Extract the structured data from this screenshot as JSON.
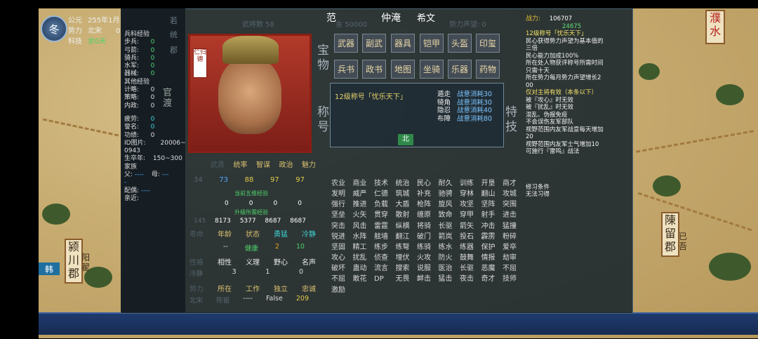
{
  "top_left": {
    "season": "冬",
    "row1_label": "公元",
    "row1_value": "255年1月1",
    "row2_label": "势力",
    "row2_value": "北宋",
    "row2_num": "0",
    "row3_label": "科技",
    "row3_value": "余0天"
  },
  "sidebar_labels": {
    "a": "若",
    "b": "统",
    "c": "郡"
  },
  "stats": {
    "header": "兵科经验",
    "rows": [
      {
        "k": "步兵:",
        "v": "0"
      },
      {
        "k": "弓箭:",
        "v": "0"
      },
      {
        "k": "骑兵:",
        "v": "0"
      },
      {
        "k": "水军:",
        "v": "0"
      },
      {
        "k": "器械:",
        "v": "0"
      }
    ],
    "other_header": "其他经验",
    "other_rows": [
      {
        "k": "计略:",
        "v": "0"
      },
      {
        "k": "策略:",
        "v": "0"
      },
      {
        "k": "内政:",
        "v": "0"
      }
    ],
    "mid_rows": [
      {
        "k": "疲劳:",
        "v": "0"
      },
      {
        "k": "誉名:",
        "v": "0"
      },
      {
        "k": "功绩:",
        "v": "0"
      }
    ],
    "id_label": "ID图片:",
    "id_value": "20006~",
    "id_value2": "0943",
    "birth_label": "生卒年:",
    "birth_value": "150~300",
    "family_label": "家族",
    "father_label": "父:",
    "father_value": "----",
    "mother_label": "母:",
    "mother_value": "---",
    "dash": "-",
    "spouse_label": "配偶:",
    "spouse_value": "----",
    "kin_label": "亲近:",
    "city_label": "官渡"
  },
  "portrait": {
    "seal_text": "仁归德"
  },
  "header": {
    "name_surname": "范",
    "name_given": "仲淹",
    "name_style": "希文",
    "ghost_1": "武将数 58",
    "ghost_2": "金 50000",
    "ghost_3": "势力声望: 0"
  },
  "treasure_label": "宝物",
  "treasure_buttons": [
    "武器",
    "副武",
    "器具",
    "铠甲",
    "头盔",
    "印玺"
  ],
  "treasure_buttons_2": [
    "兵书",
    "政书",
    "地图",
    "坐骑",
    "乐器",
    "药物"
  ],
  "title_label": "称号",
  "special_label": "特技",
  "title_box": {
    "head": "12级称号「忧乐天下」",
    "items": [
      {
        "k": "遁走",
        "v": "战意消耗30"
      },
      {
        "k": "犄角",
        "v": "战意消耗30"
      },
      {
        "k": "隐忍",
        "v": "战意消耗40"
      },
      {
        "k": "布障",
        "v": "战意消耗80"
      }
    ],
    "tag": "北"
  },
  "attr": {
    "headers": [
      "武勇",
      "统率",
      "智谋",
      "政治",
      "魅力"
    ],
    "values": [
      "34",
      "73",
      "88",
      "97",
      "97"
    ],
    "note1": "当前五维经验",
    "note2": "升级所需经验",
    "exp_now": [
      "0",
      "0",
      "0",
      "0"
    ],
    "exp_need": [
      "145",
      "8173",
      "5377",
      "8687",
      "8687"
    ],
    "row3_heads": [
      "寿命",
      "年龄",
      "状态",
      "勇猛",
      "冷静"
    ],
    "row3_vals": [
      "--",
      "健康",
      "2",
      "10"
    ],
    "row4_heads": [
      "性格",
      "相性",
      "义理",
      "野心",
      "名声"
    ],
    "row4_vals": [
      "冷静",
      "3",
      "1",
      "0"
    ],
    "row5_heads": [
      "势力",
      "所在",
      "工作",
      "独立",
      "忠诚"
    ],
    "row5_vals": [
      "北宋",
      "陈留",
      "----",
      "False",
      "209"
    ]
  },
  "skills": [
    "农业",
    "商业",
    "技术",
    "统治",
    "民心",
    "耐久",
    "训练",
    "",
    "开垦",
    "商才",
    "发明",
    "威严",
    "仁德",
    "筑城",
    "补充",
    "",
    "驰骋",
    "穿林",
    "翻山",
    "攻城",
    "强行",
    "推进",
    "负载",
    "",
    "大盾",
    "枪阵",
    "旋风",
    "攻坚",
    "坚阵",
    "突围",
    "坚垒",
    "",
    "火矢",
    "贯穿",
    "散射",
    "缠原",
    "致命",
    "穿甲",
    "射手",
    "",
    "进击",
    "突击",
    "风击",
    "雷霆",
    "纵横",
    "将骑",
    "长驱",
    "",
    "箭矢",
    "冲击",
    "猛撞",
    "锐进",
    "水阵",
    "舷墙",
    "翻江",
    "",
    "破门",
    "箭岚",
    "投石",
    "霹雳",
    "粉碎",
    "坚固",
    "精工",
    "",
    "练步",
    "练弩",
    "练骑",
    "练水",
    "练器",
    "保护",
    "爱卒",
    "",
    "攻心",
    "扰乱",
    "侦查",
    "埋伏",
    "火攻",
    "防火",
    "鼓舞",
    "",
    "情报",
    "劫审",
    "破坏",
    "蛊动",
    "流言",
    "搜索",
    "说服",
    "",
    "医治",
    "长驱",
    "恶魔",
    "不屈",
    "不屈",
    "敢花",
    "DP",
    "",
    "无畏",
    "衅击",
    "猛击",
    "夜击",
    "奇才",
    "技师",
    "激励",
    ""
  ],
  "right": {
    "power_label": "战力:",
    "power_value": "106707",
    "power_sub": "24675",
    "lines": [
      {
        "t": "12级称号「忧乐天下」",
        "c": "yellow"
      },
      {
        "t": "民心获得势力声望为基本值的",
        "c": "w"
      },
      {
        "t": "三倍",
        "c": "w"
      },
      {
        "t": "民心能力加成100%",
        "c": "w"
      },
      {
        "t": "所在处人物获评称号所需时间",
        "c": "w"
      },
      {
        "t": "只需十天",
        "c": "w"
      },
      {
        "t": "所在势力每月势力声望增长2",
        "c": "w"
      },
      {
        "t": "00",
        "c": "w"
      },
      {
        "t": "仅对主将有效（本条以下）",
        "c": "yellow"
      },
      {
        "t": "被『攻心』时无效",
        "c": "w"
      },
      {
        "t": "被『扰乱』时无效",
        "c": "w"
      },
      {
        "t": "混乱、伪报免疫",
        "c": "w"
      },
      {
        "t": "不会误伤友军部队",
        "c": "w"
      },
      {
        "t": "视野范围内友军战意每天增加",
        "c": "w"
      },
      {
        "t": "20",
        "c": "w"
      },
      {
        "t": "视野范围内友军士气增加10",
        "c": "w"
      },
      {
        "t": "可施行『雷鸣』战法",
        "c": "w"
      }
    ],
    "learn_title": "修习条件",
    "learn_value": "无法习得"
  },
  "map": {
    "sign_left": "颍川郡",
    "sign_left2": "阳翟",
    "sign_right": "陳留郡",
    "sign_right2": "已吾",
    "sign_top": "濮水",
    "flag": "韩"
  }
}
